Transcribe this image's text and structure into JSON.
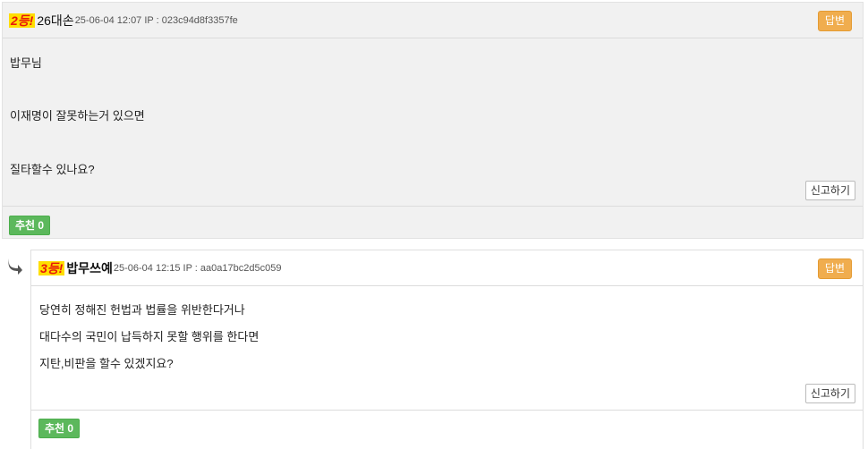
{
  "comment1": {
    "rank": "2등!",
    "nick": "26대손",
    "meta": "25-06-04 12:07 IP : 023c94d8f3357fe",
    "reply_label": "답변",
    "lines": [
      "밥무님",
      "이재명이 잘못하는거 있으면",
      "질타할수 있나요?"
    ],
    "report_label": "신고하기",
    "recommend_label": "추천 0"
  },
  "comment2": {
    "rank": "3등!",
    "nick": "밥무쓰예",
    "meta": "25-06-04 12:15 IP : aa0a17bc2d5c059",
    "reply_label": "답변",
    "lines": [
      "당연히 정해진 헌법과 법률을 위반한다거나",
      "대다수의 국민이 납득하지 못할 행위를 한다면",
      "지탄,비판을 할수 있겠지요?"
    ],
    "report_label": "신고하기",
    "recommend_label": "추천 0"
  },
  "icons": {
    "reply_indicator": "reply-arrow-icon"
  },
  "colors": {
    "accent_orange": "#f0ad4e",
    "recommend_green": "#5cb85c",
    "rank_red": "#e8160c",
    "rank_yellow": "#ffde00"
  }
}
